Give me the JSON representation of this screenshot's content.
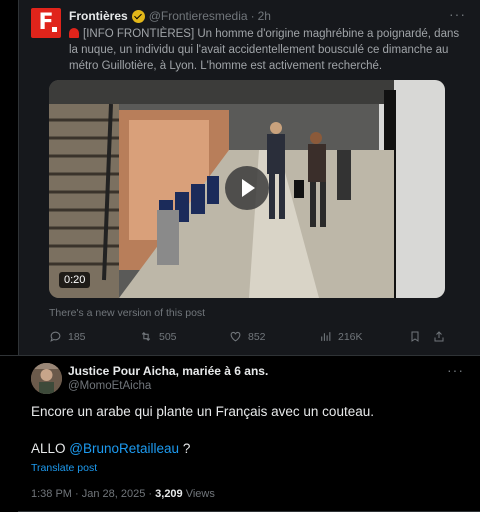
{
  "quoted_post": {
    "author_name": "Frontières",
    "handle": "@Frontieresmedia",
    "separator": "·",
    "time": "2h",
    "more": "···",
    "text_tag": "[INFO FRONTIÈRES]",
    "text_body": " Un homme d'origine maghrébine a poignardé, dans la nuque, un individu qui l'avait accidentellement bousculé ce dimanche au métro Guillotière, à Lyon. L'homme est activement recherché.",
    "video_duration": "0:20",
    "new_version_notice": "There's a new version of this post",
    "actions": {
      "replies": "185",
      "reposts": "505",
      "likes": "852",
      "views": "216K"
    },
    "colors": {
      "brand": "#e0241b",
      "verified_badge": "#e2b719"
    }
  },
  "main_post": {
    "author_name": "Justice Pour Aicha, mariée à 6 ans.",
    "handle": "@MomoEtAicha",
    "more": "···",
    "text_line1": "Encore un arabe qui plante un Français avec un couteau.",
    "text_line2_prefix": "ALLO ",
    "mention": "@BrunoRetailleau",
    "text_line2_suffix": " ?",
    "translate_label": "Translate post",
    "timestamp": "1:38 PM · Jan 28, 2025 · ",
    "views_count": "3,209",
    "views_label": " Views",
    "colors": {
      "link": "#1d9bf0",
      "muted": "#71767b"
    }
  }
}
